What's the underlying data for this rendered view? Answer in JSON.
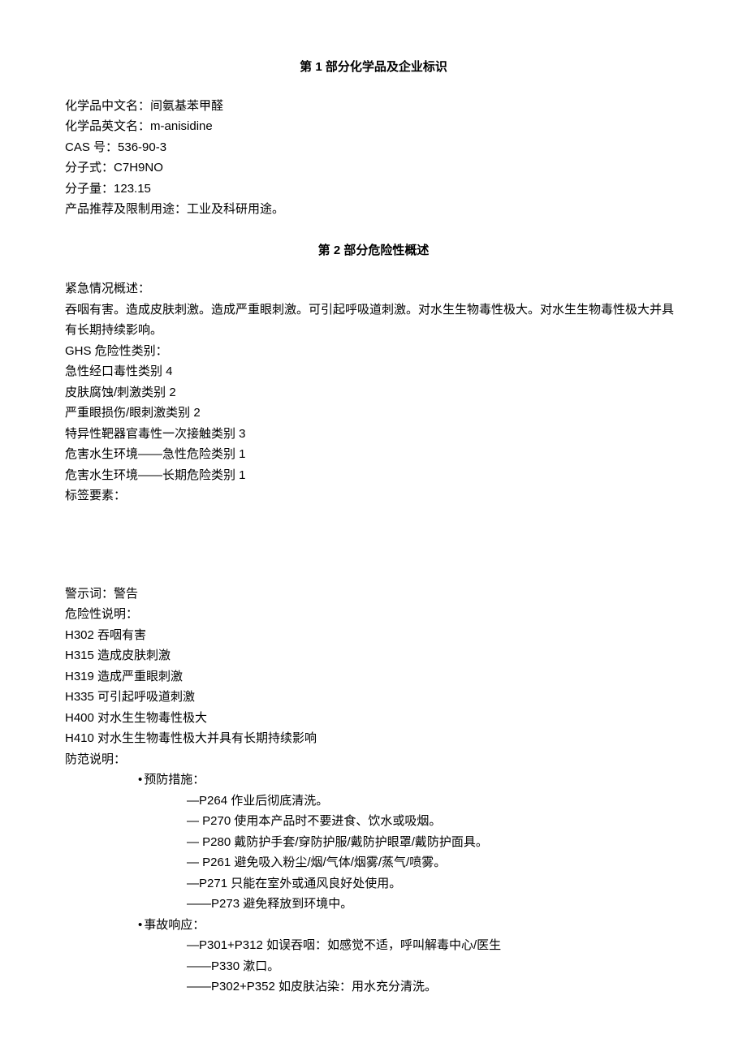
{
  "section1": {
    "title": "第 1 部分化学品及企业标识",
    "chinese_name_label": "化学品中文名：",
    "chinese_name_value": "间氨基苯甲醛",
    "english_name_label": "化学品英文名：",
    "english_name_value": "m-anisidine",
    "cas_label": "CAS 号：",
    "cas_value": "536-90-3",
    "formula_label": "分子式：",
    "formula_value": "C7H9NO",
    "mw_label": "分子量：",
    "mw_value": "123.15",
    "usage_label": "产品推荐及限制用途：",
    "usage_value": "工业及科研用途。"
  },
  "section2": {
    "title": "第 2 部分危险性概述",
    "emergency_label": "紧急情况概述：",
    "emergency_text": "吞咽有害。造成皮肤刺激。造成严重眼刺激。可引起呼吸道刺激。对水生生物毒性极大。对水生生物毒性极大并具有长期持续影响。",
    "ghs_label": "GHS 危险性类别：",
    "ghs_items": [
      "急性经口毒性类别 4",
      "皮肤腐蚀/刺激类别 2",
      "严重眼损伤/眼刺激类别 2",
      "特异性靶器官毒性一次接触类别 3",
      "危害水生环境——急性危险类别 1",
      "危害水生环境——长期危险类别 1"
    ],
    "label_elements_label": "标签要素：",
    "signal_word_label": "警示词：",
    "signal_word_value": "警告",
    "hazard_statement_label": "危险性说明：",
    "hazard_statements": [
      "H302 吞咽有害",
      "H315 造成皮肤刺激",
      "H319 造成严重眼刺激",
      "H335 可引起呼吸道刺激",
      "H400 对水生生物毒性极大",
      "H410 对水生生物毒性极大并具有长期持续影响"
    ],
    "precaution_label": "防范说明：",
    "prevention_header": "预防措施：",
    "prevention_items": [
      {
        "prefix": "tight",
        "text": "P264 作业后彻底清洗。"
      },
      {
        "prefix": "spaced",
        "text": "P270 使用本产品时不要进食、饮水或吸烟。"
      },
      {
        "prefix": "spaced",
        "text": "P280 戴防护手套/穿防护服/戴防护眼罩/戴防护面具。"
      },
      {
        "prefix": "spaced",
        "text": "P261 避免吸入粉尘/烟/气体/烟雾/蒸气/喷雾。"
      },
      {
        "prefix": "tight",
        "text": "P271 只能在室外或通风良好处使用。"
      },
      {
        "prefix": "long",
        "text": "P273 避免释放到环境中。"
      }
    ],
    "response_header": "事故响应：",
    "response_items": [
      {
        "prefix": "tight",
        "text": "P301+P312 如误吞咽：如感觉不适，呼叫解毒中心/医生"
      },
      {
        "prefix": "long",
        "text": "P330 漱口。"
      },
      {
        "prefix": "long",
        "text": "P302+P352 如皮肤沾染：用水充分清洗。"
      }
    ]
  }
}
